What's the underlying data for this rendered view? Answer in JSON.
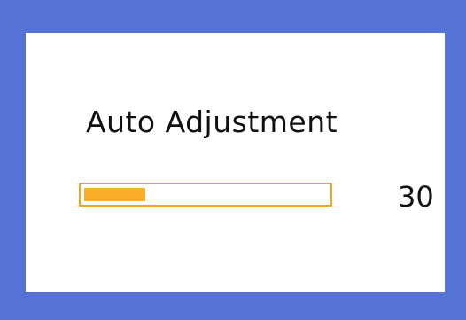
{
  "osd": {
    "title": "Auto Adjustment",
    "progress": {
      "value_text": "30",
      "fraction": 0.25
    }
  },
  "colors": {
    "frame": "#5572d6",
    "panel": "#ffffff",
    "bar_border": "#f0a81e",
    "bar_fill": "#f9ad2a",
    "text": "#111111"
  }
}
